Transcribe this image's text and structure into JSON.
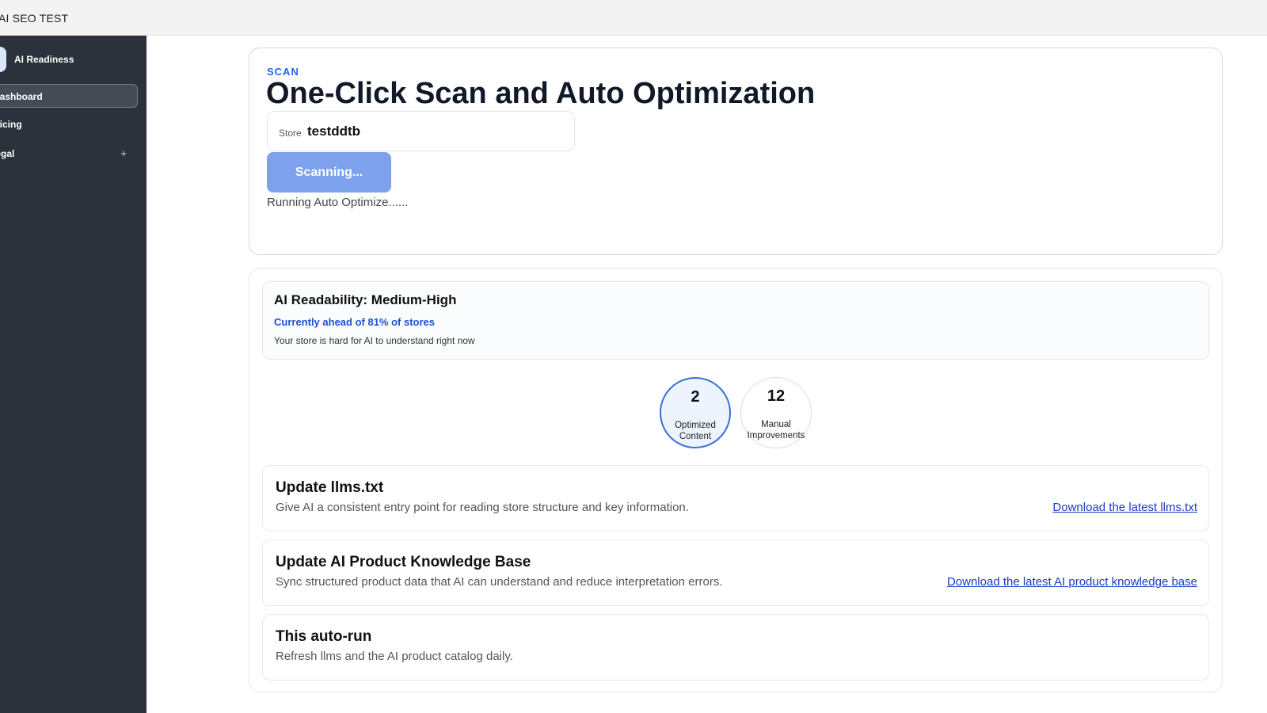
{
  "app": {
    "title": "AI SEO TEST"
  },
  "sidebar": {
    "brand": "AI Readiness",
    "items": [
      {
        "label": "Dashboard"
      },
      {
        "label": "Pricing"
      },
      {
        "label": "Legal",
        "expand": "+"
      }
    ]
  },
  "scan": {
    "eyebrow": "SCAN",
    "title": "One-Click Scan and Auto Optimization",
    "store_label": "Store",
    "store_value": "testddtb",
    "button_label": "Scanning...",
    "status": "Running Auto Optimize......"
  },
  "readability": {
    "title": "AI Readability: Medium-High",
    "rank": "Currently ahead of 81% of stores",
    "description": "Your store is hard for AI to understand right now"
  },
  "stats": [
    {
      "value": "2",
      "label_line1": "Optimized",
      "label_line2": "Content"
    },
    {
      "value": "12",
      "label_line1": "Manual",
      "label_line2": "Improvements"
    }
  ],
  "actions": [
    {
      "title": "Update llms.txt",
      "description": "Give AI a consistent entry point for reading store structure and key information.",
      "link": "Download the latest llms.txt"
    },
    {
      "title": "Update AI Product Knowledge Base",
      "description": "Sync structured product data that AI can understand and reduce interpretation errors.",
      "link": "Download the latest AI product knowledge base"
    },
    {
      "title": "This auto-run",
      "description": "Refresh llms and the AI product catalog daily."
    }
  ],
  "colors": {
    "accent": "#2563eb",
    "button": "#7ea1ee",
    "sidebar": "#2b323b",
    "link": "#1d39c4"
  },
  "icons": {
    "expand": "plus-icon",
    "brand": "brand-logo"
  }
}
